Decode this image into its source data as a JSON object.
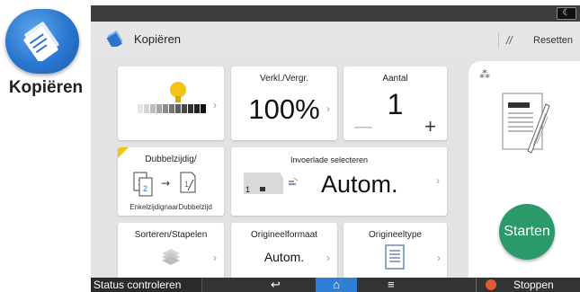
{
  "app": {
    "label": "Kopiëren",
    "icon": "copy-app-icon"
  },
  "header": {
    "title": "Kopiëren",
    "reset_label": "Resetten",
    "moon_icon": "moon-icon"
  },
  "tiles": {
    "density": {
      "icon": "brightness-bulb-icon",
      "level_fraction": 0.5
    },
    "ratio": {
      "title": "Verkl./Vergr.",
      "value": "100%"
    },
    "count": {
      "title": "Aantal",
      "value": "1",
      "minus": "—",
      "plus": "+"
    },
    "duplex": {
      "title": "Dubbelzijdig/",
      "subtitle": "EnkelzijdignaarDubbelzijd",
      "icon": "duplex-icon"
    },
    "tray": {
      "title": "Invoerlade selecteren",
      "value": "Autom.",
      "tray_number": "1"
    },
    "sort": {
      "title": "Sorteren/Stapelen",
      "icon": "sort-stack-icon"
    },
    "original_size": {
      "title": "Origineelformaat",
      "value": "Autom."
    },
    "original_type": {
      "title": "Origineeltype",
      "icon": "document-type-icon"
    }
  },
  "preview": {
    "icon": "preview-settings-icon"
  },
  "start": {
    "label": "Starten"
  },
  "bottom": {
    "status_label": "Status controleren",
    "back_icon": "back-arrow-icon",
    "home_icon": "home-icon",
    "menu_icon": "menu-icon",
    "stop_label": "Stoppen"
  },
  "colors": {
    "accent_blue": "#2f7fd6",
    "start_green": "#2b9a6a",
    "highlight_yellow": "#f3c316",
    "stop_orange": "#e05a32"
  }
}
